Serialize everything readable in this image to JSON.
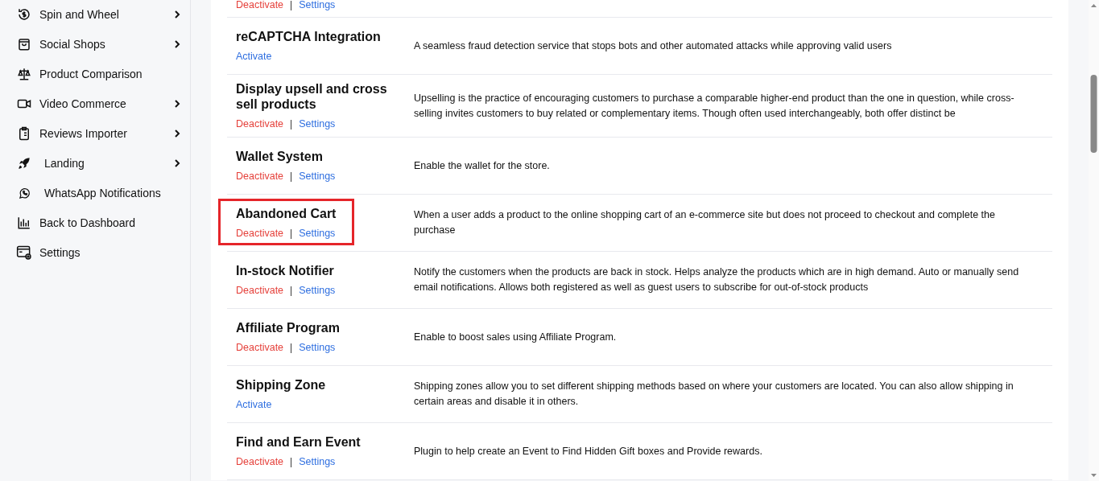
{
  "sidebar": {
    "items": [
      {
        "label": "Spin and Wheel",
        "kind": "spin",
        "has_submenu": true
      },
      {
        "label": "Social Shops",
        "kind": "bag",
        "has_submenu": true
      },
      {
        "label": "Product Comparison",
        "kind": "scale",
        "has_submenu": false
      },
      {
        "label": "Video Commerce",
        "kind": "video",
        "has_submenu": true
      },
      {
        "label": "Reviews Importer",
        "kind": "clipboard",
        "has_submenu": true
      },
      {
        "label": "Landing",
        "kind": "rocket",
        "has_submenu": true
      },
      {
        "label": "WhatsApp Notifications",
        "kind": "whatsapp",
        "has_submenu": false
      },
      {
        "label": "Back to Dashboard",
        "kind": "chart",
        "has_submenu": false
      },
      {
        "label": "Settings",
        "kind": "settings",
        "has_submenu": false
      }
    ]
  },
  "partial_row": {
    "actions": [
      {
        "label": "Deactivate",
        "kind": "deactivate"
      },
      {
        "label": "Settings",
        "kind": "settings"
      }
    ],
    "separator": "|"
  },
  "plugins": [
    {
      "title": "reCAPTCHA Integration",
      "actions": [
        {
          "label": "Activate",
          "kind": "activate"
        }
      ],
      "description": "A seamless fraud detection service that stops bots and other automated attacks while approving valid users",
      "highlighted": false
    },
    {
      "title": "Display upsell and cross sell products",
      "actions": [
        {
          "label": "Deactivate",
          "kind": "deactivate"
        },
        {
          "label": "Settings",
          "kind": "settings"
        }
      ],
      "separator": "|",
      "description": "Upselling is the practice of encouraging customers to purchase a comparable higher-end product than the one in question, while cross-selling invites customers to buy related or complementary items. Though often used interchangeably, both offer distinct be",
      "highlighted": false
    },
    {
      "title": "Wallet System",
      "actions": [
        {
          "label": "Deactivate",
          "kind": "deactivate"
        },
        {
          "label": "Settings",
          "kind": "settings"
        }
      ],
      "separator": "|",
      "description": "Enable the wallet for the store.",
      "highlighted": false
    },
    {
      "title": "Abandoned Cart",
      "actions": [
        {
          "label": "Deactivate",
          "kind": "deactivate"
        },
        {
          "label": "Settings",
          "kind": "settings"
        }
      ],
      "separator": "|",
      "description": "When a user adds a product to the online shopping cart of an e-commerce site but does not proceed to checkout and complete the purchase",
      "highlighted": true
    },
    {
      "title": "In-stock Notifier",
      "actions": [
        {
          "label": "Deactivate",
          "kind": "deactivate"
        },
        {
          "label": "Settings",
          "kind": "settings"
        }
      ],
      "separator": "|",
      "description": "Notify the customers when the products are back in stock. Helps analyze the products which are in high demand. Auto or manually send email notifications. Allows both registered as well as guest users to subscribe for out-of-stock products",
      "highlighted": false
    },
    {
      "title": "Affiliate Program",
      "actions": [
        {
          "label": "Deactivate",
          "kind": "deactivate"
        },
        {
          "label": "Settings",
          "kind": "settings"
        }
      ],
      "separator": "|",
      "description": "Enable to boost sales using Affiliate Program.",
      "highlighted": false
    },
    {
      "title": "Shipping Zone",
      "actions": [
        {
          "label": "Activate",
          "kind": "activate"
        }
      ],
      "description": "Shipping zones allow you to set different shipping methods based on where your customers are located. You can also allow shipping in certain areas and disable it in others.",
      "highlighted": false
    },
    {
      "title": "Find and Earn Event",
      "actions": [
        {
          "label": "Deactivate",
          "kind": "deactivate"
        },
        {
          "label": "Settings",
          "kind": "settings"
        }
      ],
      "separator": "|",
      "description": "Plugin to help create an Event to Find Hidden Gift boxes and Provide rewards.",
      "highlighted": false
    }
  ]
}
